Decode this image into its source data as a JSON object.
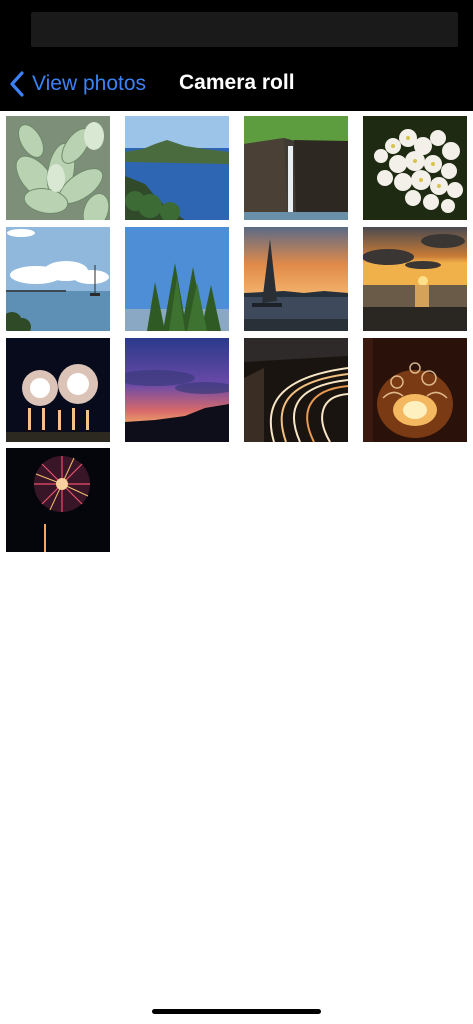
{
  "nav": {
    "back_label": "View photos",
    "title": "Camera roll"
  },
  "colors": {
    "nav_background": "#000000",
    "accent": "#3b82f6",
    "content_background": "#ffffff"
  },
  "photos": [
    {
      "subject": "succulent"
    },
    {
      "subject": "lake"
    },
    {
      "subject": "waterfall"
    },
    {
      "subject": "white-flowers"
    },
    {
      "subject": "sailboat-sea"
    },
    {
      "subject": "trees"
    },
    {
      "subject": "sailboat-sunset"
    },
    {
      "subject": "sunset-sea"
    },
    {
      "subject": "fireworks-multiple"
    },
    {
      "subject": "dusk-sky"
    },
    {
      "subject": "light-trails"
    },
    {
      "subject": "candle"
    },
    {
      "subject": "firework"
    }
  ]
}
